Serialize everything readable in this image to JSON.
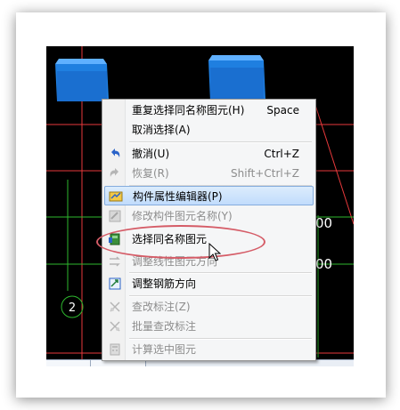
{
  "canvas": {
    "axis_labels": [
      {
        "text": "2"
      },
      {
        "text": "00"
      },
      {
        "text": "00"
      }
    ]
  },
  "context_menu": {
    "items": [
      {
        "label": "重复选择同名称图元(H)",
        "shortcut": "Space",
        "enabled": true,
        "icon": ""
      },
      {
        "label": "取消选择(A)",
        "shortcut": "",
        "enabled": true,
        "icon": ""
      },
      {
        "label": "撤消(U)",
        "shortcut": "Ctrl+Z",
        "enabled": true,
        "icon": "undo-icon"
      },
      {
        "label": "恢复(R)",
        "shortcut": "Shift+Ctrl+Z",
        "enabled": false,
        "icon": "redo-icon"
      },
      {
        "label": "构件属性编辑器(P)",
        "shortcut": "",
        "enabled": true,
        "highlighted": true,
        "icon": "property-editor-icon"
      },
      {
        "label": "修改构件图元名称(Y)",
        "shortcut": "",
        "enabled": false,
        "icon": "rename-element-icon"
      },
      {
        "label": "选择同名称图元",
        "shortcut": "",
        "enabled": true,
        "icon": "select-same-name-icon"
      },
      {
        "label": "调整线性图元方向",
        "shortcut": "",
        "enabled": false,
        "icon": "adjust-direction-icon"
      },
      {
        "label": "调整钢筋方向",
        "shortcut": "",
        "enabled": true,
        "icon": "rebar-direction-icon"
      },
      {
        "label": "查改标注(Z)",
        "shortcut": "",
        "enabled": false,
        "icon": "edit-annotation-icon"
      },
      {
        "label": "批量查改标注",
        "shortcut": "",
        "enabled": false,
        "icon": "batch-annotation-icon"
      },
      {
        "label": "计算选中图元",
        "shortcut": "",
        "enabled": false,
        "icon": "calculate-icon"
      }
    ]
  },
  "colors": {
    "canvas_background": "#000000",
    "grid_red": "#e8393b",
    "grid_green": "#2eb82e",
    "element_blue": "#1f7fe0",
    "highlight_ellipse": "#d55c67"
  }
}
